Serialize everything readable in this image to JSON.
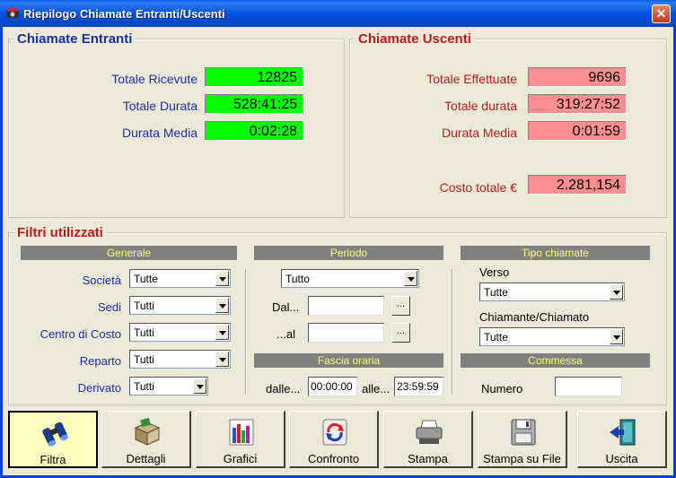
{
  "window": {
    "title": "Riepilogo Chiamate Entranti/Uscenti",
    "close": "✕"
  },
  "entranti": {
    "title": "Chiamate Entranti",
    "rows": [
      {
        "label": "Totale Ricevute",
        "value": "12825"
      },
      {
        "label": "Totale Durata",
        "value": "528:41:25"
      },
      {
        "label": "Durata Media",
        "value": "0:02:28"
      }
    ]
  },
  "uscenti": {
    "title": "Chiamate Uscenti",
    "rows": [
      {
        "label": "Totale Effettuate",
        "value": "9696"
      },
      {
        "label": "Totale durata",
        "value": "319:27:52"
      },
      {
        "label": "Durata Media",
        "value": "0:01:59"
      }
    ],
    "costo_label": "Costo totale €",
    "costo_value": "2.281,154"
  },
  "filtri": {
    "title": "Filtri utilizzati",
    "generale": {
      "header": "Generale",
      "fields": [
        {
          "label": "Società",
          "value": "Tutte"
        },
        {
          "label": "Sedi",
          "value": "Tutti"
        },
        {
          "label": "Centro di Costo",
          "value": "Tutti"
        },
        {
          "label": "Reparto",
          "value": "Tutti"
        },
        {
          "label": "Derivato",
          "value": "Tutti"
        }
      ]
    },
    "periodo": {
      "header": "Periodo",
      "value": "Tutto",
      "dal_label": "Dal...",
      "al_label": "...al",
      "btn": "...",
      "fascia_header": "Fascia oraria",
      "dalle_label": "dalle...",
      "dalle_value": "00:00:00",
      "alle_label": "alle...",
      "alle_value": "23:59:59"
    },
    "tipo": {
      "header": "Tipo chiamate",
      "verso_label": "Verso",
      "verso_value": "Tutte",
      "chiamante_label": "Chiamante/Chiamato",
      "chiamante_value": "Tutte",
      "commessa_header": "Commessa",
      "numero_label": "Numero"
    }
  },
  "toolbar": [
    {
      "label": "Filtra",
      "icon": "binoculars-icon"
    },
    {
      "label": "Dettagli",
      "icon": "box-icon"
    },
    {
      "label": "Grafici",
      "icon": "bar-chart-icon"
    },
    {
      "label": "Confronto",
      "icon": "refresh-icon"
    },
    {
      "label": "Stampa",
      "icon": "printer-icon"
    },
    {
      "label": "Stampa su File",
      "icon": "floppy-disk-icon"
    },
    {
      "label": "Uscita",
      "icon": "exit-door-icon"
    }
  ]
}
